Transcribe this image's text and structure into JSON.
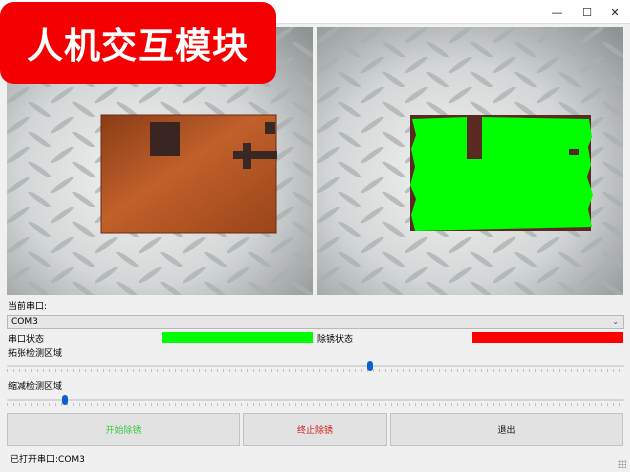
{
  "window": {
    "title": "",
    "minimize_glyph": "—",
    "maximize_glyph": "☐",
    "close_glyph": "✕"
  },
  "banner": {
    "text": "人机交互模块"
  },
  "serial": {
    "current_port_label": "当前串口:",
    "selected_port": "COM3",
    "port_status_label": "串口状态",
    "port_status_color": "#00ff00",
    "rust_status_label": "除锈状态",
    "rust_status_color": "#ff0000"
  },
  "sliders": {
    "expand": {
      "label": "拓张检测区域",
      "value_fraction": 0.59
    },
    "shrink": {
      "label": "缩减检测区域",
      "value_fraction": 0.09
    }
  },
  "buttons": {
    "start": "开始除锈",
    "stop": "终止除锈",
    "exit": "退出"
  },
  "footer": {
    "status": "已打开串口:COM3"
  },
  "icons": {
    "dropdown": "chevron-down-icon",
    "resize": "resize-grip-icon"
  },
  "colors": {
    "banner_bg": "#f40000",
    "detect_overlay": "#00ff00",
    "rust_plate": "#b5521d",
    "slider_thumb": "#0a5fd1"
  }
}
